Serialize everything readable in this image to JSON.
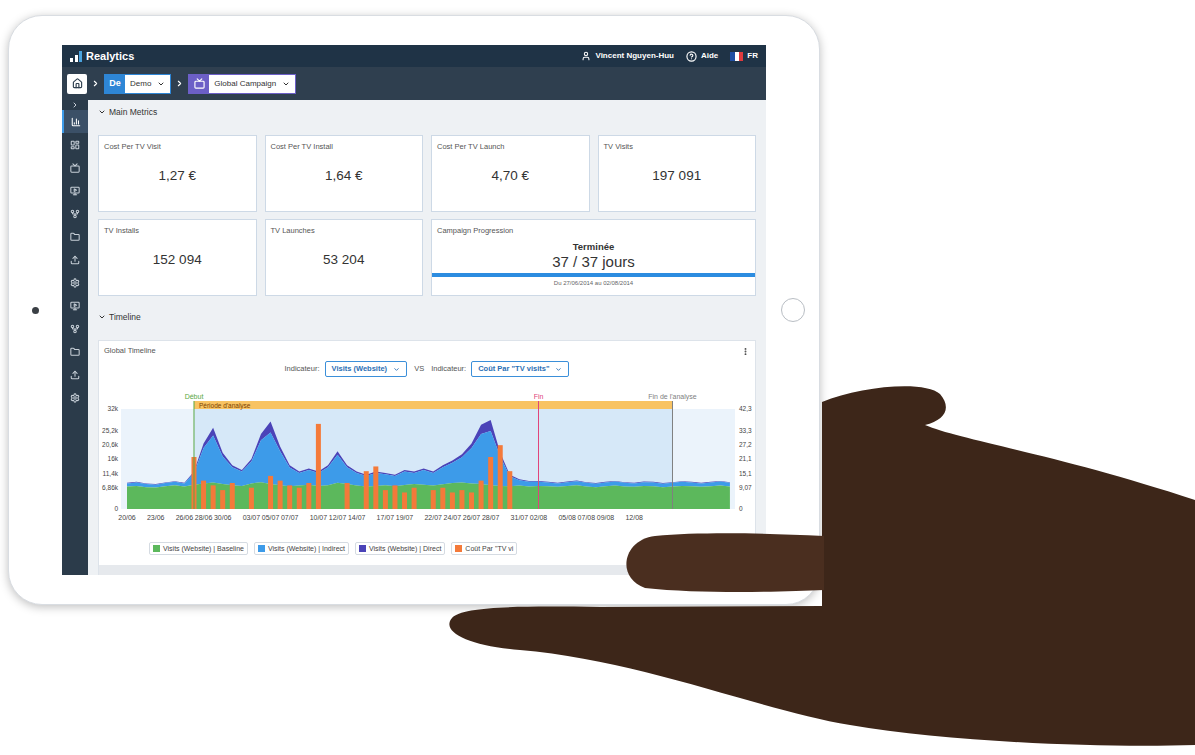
{
  "top_bar": {
    "logo": "Realytics",
    "user": "Vincent Nguyen-Huu",
    "help": "Aide",
    "language": "FR"
  },
  "breadcrumb": {
    "org_badge": "De",
    "org": "Demo",
    "campaign": "Global Campaign"
  },
  "sidebar": {
    "items": [
      {
        "selected": true
      },
      {
        "selected": false
      },
      {
        "selected": false
      },
      {
        "selected": false
      },
      {
        "selected": false
      },
      {
        "selected": false
      },
      {
        "selected": false
      },
      {
        "selected": false
      },
      {
        "selected": false
      },
      {
        "selected": false
      },
      {
        "selected": false
      },
      {
        "selected": false
      },
      {
        "selected": false
      }
    ]
  },
  "main_metrics": {
    "title": "Main Metrics",
    "cards": [
      {
        "label": "Cost Per TV Visit",
        "value": "1,27 €"
      },
      {
        "label": "Cost Per TV Install",
        "value": "1,64 €"
      },
      {
        "label": "Cost Per TV Launch",
        "value": "4,70 €"
      },
      {
        "label": "TV Visits",
        "value": "197 091"
      },
      {
        "label": "TV Installs",
        "value": "152 094"
      },
      {
        "label": "TV Launches",
        "value": "53 204"
      }
    ],
    "progress": {
      "label": "Campaign Progression",
      "status": "Terminée",
      "value": "37 / 37 jours",
      "level": 1,
      "dates": "Du 27/06/2014 au 02/08/2014"
    }
  },
  "timeline": {
    "title": "Timeline",
    "panel_title": "Global Timeline",
    "indicator_label": "Indicateur:",
    "vs": "VS",
    "indicators": [
      "Visits (Website)",
      "Coût Par \"TV visits\""
    ],
    "chart": {
      "left_axis": [
        {
          "label": "32k",
          "value": 32000
        },
        {
          "label": "25,2k",
          "value": 25200
        },
        {
          "label": "20,6k",
          "value": 20600
        },
        {
          "label": "16k",
          "value": 16000
        },
        {
          "label": "11,4k",
          "value": 11400
        },
        {
          "label": "6,86k",
          "value": 6860
        },
        {
          "label": "0",
          "value": 0
        }
      ],
      "right_axis": [
        {
          "label": "42,3",
          "value": 42.3
        },
        {
          "label": "33,3",
          "value": 33.3
        },
        {
          "label": "27,2",
          "value": 27.2
        },
        {
          "label": "21,1",
          "value": 21.1
        },
        {
          "label": "15,1",
          "value": 15.1
        },
        {
          "label": "9,07",
          "value": 9.07
        },
        {
          "label": "0",
          "value": 0
        }
      ],
      "x_ticks": [
        {
          "label": "20/06",
          "index": 0
        },
        {
          "label": "23/06",
          "index": 3
        },
        {
          "label": "26/06",
          "index": 6
        },
        {
          "label": "28/06",
          "index": 8
        },
        {
          "label": "30/06",
          "index": 10
        },
        {
          "label": "03/07",
          "index": 13
        },
        {
          "label": "05/07",
          "index": 15
        },
        {
          "label": "07/07",
          "index": 17
        },
        {
          "label": "10/07",
          "index": 20
        },
        {
          "label": "12/07",
          "index": 22
        },
        {
          "label": "14/07",
          "index": 24
        },
        {
          "label": "17/07",
          "index": 27
        },
        {
          "label": "19/07",
          "index": 29
        },
        {
          "label": "22/07",
          "index": 32
        },
        {
          "label": "24/07",
          "index": 34
        },
        {
          "label": "26/07",
          "index": 36
        },
        {
          "label": "28/07",
          "index": 38
        },
        {
          "label": "31/07",
          "index": 41
        },
        {
          "label": "02/08",
          "index": 43
        },
        {
          "label": "05/08",
          "index": 46
        },
        {
          "label": "07/08",
          "index": 48
        },
        {
          "label": "09/08",
          "index": 50
        },
        {
          "label": "12/08",
          "index": 53
        }
      ],
      "band": {
        "label": "Période d'analyse",
        "start": 7,
        "end": 57
      },
      "markers": [
        {
          "label": "Début",
          "index": 7,
          "color": "#5aa845"
        },
        {
          "label": "Fin",
          "index": 43,
          "color": "#e0457b"
        },
        {
          "label": "Fin de l'analyse",
          "index": 57,
          "color": "#808080"
        }
      ],
      "series": [
        {
          "label": "Visits (Website) | Baseline",
          "kind": "area",
          "color": "#5cb85c",
          "values": [
            7200,
            7400,
            7000,
            6900,
            7300,
            7600,
            7200,
            7800,
            8200,
            8500,
            8000,
            7600,
            7400,
            8200,
            8600,
            8000,
            7600,
            7300,
            7500,
            7800,
            7400,
            7600,
            8400,
            8000,
            7500,
            7200,
            7400,
            7600,
            7300,
            7700,
            8000,
            7800,
            7500,
            7900,
            8300,
            8500,
            8200,
            8000,
            7600,
            7400,
            7300,
            7500,
            7200,
            7400,
            7300,
            7100,
            7400,
            7600,
            7200,
            7000,
            7300,
            7500,
            7200,
            7100,
            7400,
            7300,
            7000,
            7200,
            7400,
            7300,
            7100,
            7300,
            7500,
            7200
          ]
        },
        {
          "label": "Visits (Website) | Indirect",
          "kind": "area",
          "color": "#3d9be9",
          "values": [
            1000,
            1100,
            1000,
            900,
            1000,
            1100,
            1000,
            3700,
            11300,
            15000,
            8800,
            5800,
            4600,
            7000,
            13400,
            16500,
            10900,
            6000,
            4000,
            4700,
            4100,
            5800,
            9000,
            5400,
            4000,
            3400,
            4100,
            3500,
            3300,
            4300,
            3500,
            4700,
            4000,
            5500,
            6500,
            8100,
            11300,
            16000,
            17400,
            9400,
            3200,
            1700,
            1500,
            1300,
            1200,
            1100,
            1200,
            1300,
            1200,
            1100,
            1200,
            1300,
            1200,
            1100,
            1200,
            1200,
            1100,
            1200,
            1300,
            1200,
            1100,
            1200,
            1300,
            1200
          ]
        },
        {
          "label": "Visits (Website) | Direct",
          "kind": "area",
          "color": "#4b43b8",
          "values": [
            200,
            200,
            200,
            200,
            200,
            200,
            200,
            500,
            1500,
            2500,
            1200,
            600,
            500,
            800,
            2000,
            3500,
            1500,
            700,
            500,
            500,
            500,
            600,
            1100,
            600,
            500,
            400,
            500,
            400,
            400,
            500,
            500,
            500,
            500,
            600,
            700,
            900,
            1500,
            3000,
            3500,
            1200,
            500,
            300,
            300,
            300,
            200,
            200,
            200,
            200,
            200,
            200,
            200,
            200,
            200,
            200,
            200,
            200,
            200,
            200,
            200,
            200,
            200,
            200,
            200,
            200
          ]
        },
        {
          "label": "Coût Par \"TV vi",
          "kind": "bar",
          "color": "#f47a3a",
          "values": [
            0,
            0,
            0,
            0,
            0,
            0,
            0,
            22,
            12,
            10,
            8,
            11,
            0,
            9,
            0,
            14,
            12,
            10,
            9,
            11,
            36,
            0,
            0,
            11,
            0,
            16,
            18,
            8,
            10,
            7,
            9,
            0,
            8,
            9,
            7,
            8,
            7,
            12,
            22,
            27,
            16,
            0,
            0,
            0,
            0,
            0,
            0,
            0,
            0,
            0,
            0,
            0,
            0,
            0,
            0,
            0,
            0,
            0,
            0,
            0,
            0,
            0,
            0,
            0
          ]
        }
      ]
    }
  }
}
